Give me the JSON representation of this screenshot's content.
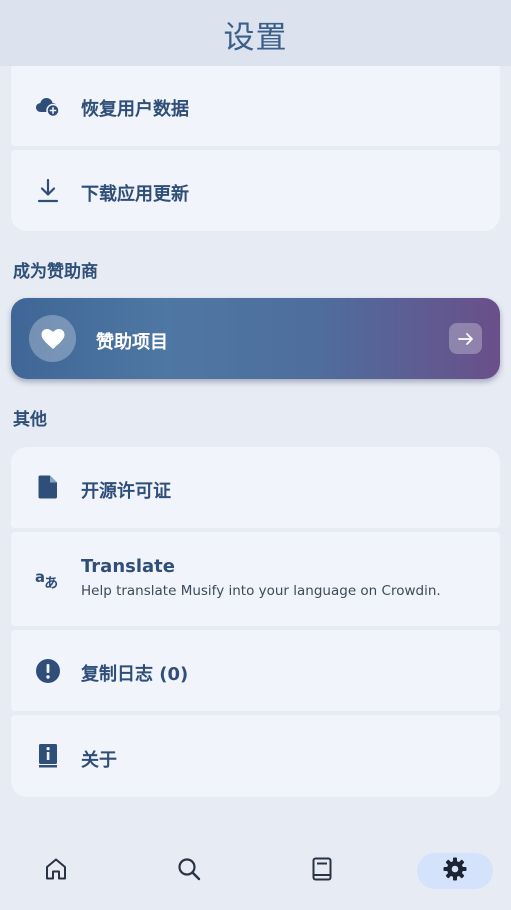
{
  "app_bar": {
    "title": "设置"
  },
  "settings": {
    "restore_user_data": "恢复用户数据",
    "download_update": "下载应用更新"
  },
  "sponsor_section": {
    "header": "成为赞助商",
    "card_label": "赞助项目"
  },
  "other_section": {
    "header": "其他",
    "licenses": "开源许可证",
    "translate_title": "Translate",
    "translate_subtitle": "Help translate Musify into your language on Crowdin.",
    "copy_logs": "复制日志 (0)",
    "about": "关于"
  },
  "bottom_nav": {
    "items": [
      {
        "icon": "home-icon",
        "active": false
      },
      {
        "icon": "search-icon",
        "active": false
      },
      {
        "icon": "library-book-icon",
        "active": false
      },
      {
        "icon": "gear-icon",
        "active": true
      }
    ]
  },
  "colors": {
    "accent": "#2f4f78",
    "background": "#e7ebf3",
    "card": "#f2f4fb",
    "app_bar": "#dde3ee",
    "nav_active": "#d4e2fb"
  }
}
